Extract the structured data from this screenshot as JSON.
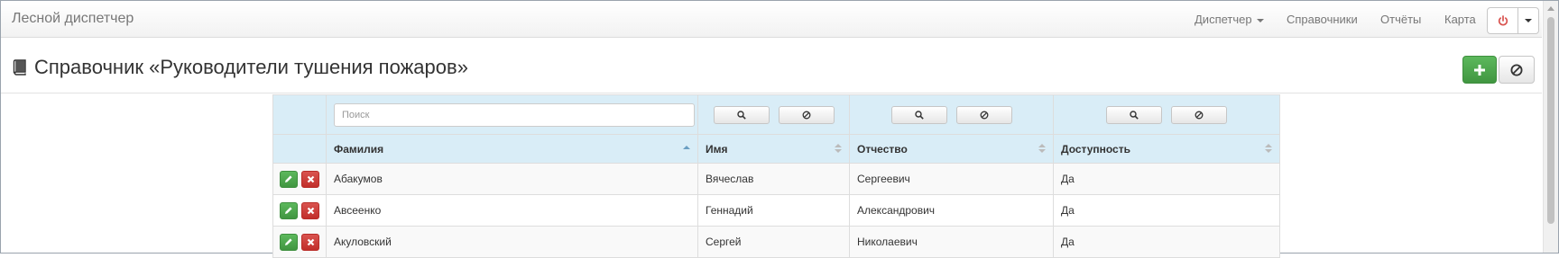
{
  "navbar": {
    "brand": "Лесной диспетчер",
    "items": [
      {
        "label": "Диспетчер"
      },
      {
        "label": "Справочники"
      },
      {
        "label": "Отчёты"
      },
      {
        "label": "Карта"
      }
    ]
  },
  "page": {
    "title": "Справочник «Руководители тушения пожаров»"
  },
  "filters": {
    "search_placeholder": "Поиск"
  },
  "table": {
    "columns": [
      "Фамилия",
      "Имя",
      "Отчество",
      "Доступность"
    ],
    "sorted_column": "Фамилия",
    "rows": [
      [
        "Абакумов",
        "Вячеслав",
        "Сергеевич",
        "Да"
      ],
      [
        "Авсеенко",
        "Геннадий",
        "Александрович",
        "Да"
      ],
      [
        "Акуловский",
        "Сергей",
        "Николаевич",
        "Да"
      ]
    ]
  },
  "colors": {
    "success": "#5cb85c",
    "danger": "#d9534f",
    "header_bg": "#d9edf7",
    "power_icon": "#d9534f"
  },
  "icons": [
    "book-icon",
    "plus-icon",
    "ban-icon",
    "search-icon",
    "power-icon",
    "pencil-icon",
    "remove-icon",
    "sort-icon"
  ]
}
